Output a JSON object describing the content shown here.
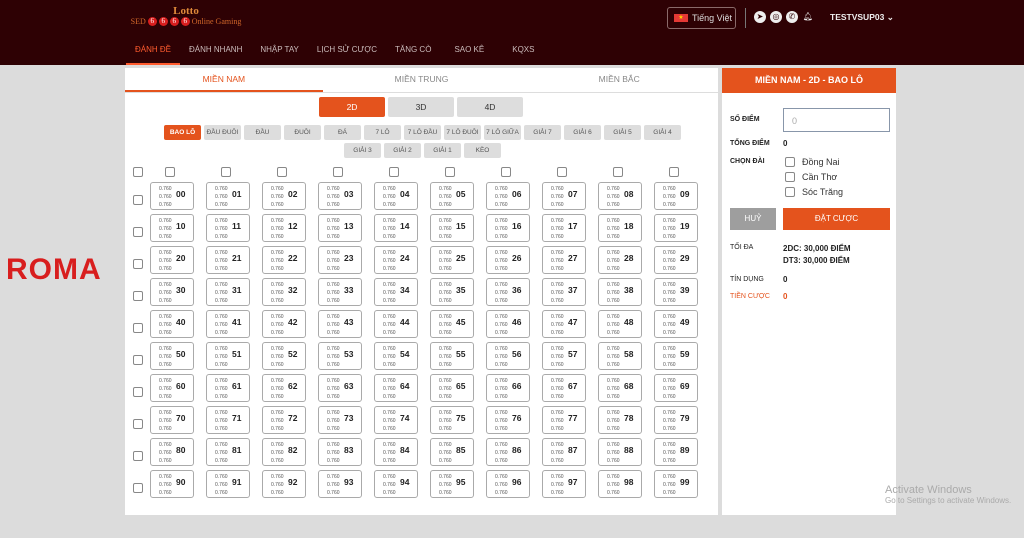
{
  "header": {
    "logo_title": "Lotto",
    "logo_sub_left": "SED",
    "logo_balls": [
      "6",
      "6",
      "6",
      "6"
    ],
    "logo_sub_right": "Online Gaming",
    "language": "Tiếng Việt",
    "username": "TESTVSUP03",
    "nav": [
      "ĐÁNH ĐỀ",
      "ĐÁNH NHANH",
      "NHẬP TAY",
      "LỊCH SỬ CƯỢC",
      "TĂNG CÒ",
      "SAO KÊ",
      "KQXS"
    ]
  },
  "regions": [
    "MIỀN NAM",
    "MIỀN TRUNG",
    "MIỀN BẮC"
  ],
  "digit_tabs": [
    "2D",
    "3D",
    "4D"
  ],
  "bet_types": [
    "BAO LÔ",
    "ĐẦU ĐUÔI",
    "ĐẦU",
    "ĐUÔI",
    "ĐÁ",
    "7 LÔ",
    "7 LÔ ĐẦU",
    "7 LÔ ĐUÔI",
    "7 LÔ GIỮA",
    "GIẢI 7",
    "GIẢI 6",
    "GIẢI 5",
    "GIẢI 4",
    "GIẢI 3",
    "GIẢI 2",
    "GIẢI 1",
    "KÈO"
  ],
  "odds": "0.760",
  "numbers": [
    "00",
    "01",
    "02",
    "03",
    "04",
    "05",
    "06",
    "07",
    "08",
    "09",
    "10",
    "11",
    "12",
    "13",
    "14",
    "15",
    "16",
    "17",
    "18",
    "19",
    "20",
    "21",
    "22",
    "23",
    "24",
    "25",
    "26",
    "27",
    "28",
    "29",
    "30",
    "31",
    "32",
    "33",
    "34",
    "35",
    "36",
    "37",
    "38",
    "39",
    "40",
    "41",
    "42",
    "43",
    "44",
    "45",
    "46",
    "47",
    "48",
    "49",
    "50",
    "51",
    "52",
    "53",
    "54",
    "55",
    "56",
    "57",
    "58",
    "59",
    "60",
    "61",
    "62",
    "63",
    "64",
    "65",
    "66",
    "67",
    "68",
    "69",
    "70",
    "71",
    "72",
    "73",
    "74",
    "75",
    "76",
    "77",
    "78",
    "79",
    "80",
    "81",
    "82",
    "83",
    "84",
    "85",
    "86",
    "87",
    "88",
    "89",
    "90",
    "91",
    "92",
    "93",
    "94",
    "95",
    "96",
    "97",
    "98",
    "99"
  ],
  "side": {
    "title": "MIỀN NAM - 2D - BAO LÔ",
    "so_diem_label": "SỐ ĐIỂM",
    "so_diem_placeholder": "0",
    "tong_diem_label": "TỔNG ĐIỂM",
    "tong_diem": "0",
    "chon_dai_label": "CHỌN ĐÀI",
    "stations": [
      "Đồng Nai",
      "Cần Thơ",
      "Sóc Trăng"
    ],
    "cancel": "HUỶ",
    "submit": "ĐẶT CƯỢC",
    "toi_da_label": "TỐI ĐA",
    "toi_da_1": "2DC: 30,000 ĐIỂM",
    "toi_da_2": "DT3: 30,000 ĐIỂM",
    "tin_dung_label": "TÍN DỤNG",
    "tin_dung": "0",
    "tien_cuoc_label": "TIỀN CƯỢC",
    "tien_cuoc": "0"
  },
  "brand": "ROMA",
  "watermark": {
    "title": "Activate Windows",
    "sub": "Go to Settings to activate Windows."
  }
}
